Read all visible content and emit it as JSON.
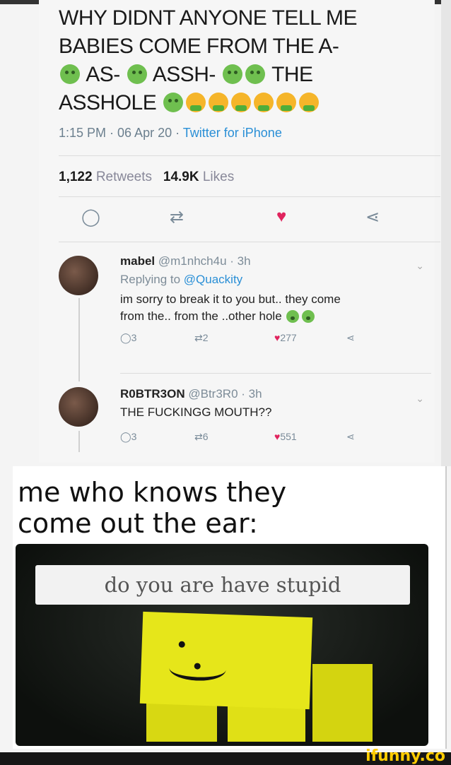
{
  "tweet": {
    "line1": "WHY DIDNT ANYONE TELL ME",
    "line2": "BABIES COME FROM THE A-",
    "line3_a": "AS-",
    "line3_b": "ASSH-",
    "line3_c": "THE",
    "line4": "ASSHOLE",
    "meta_time": "1:15 PM · 06 Apr 20 · ",
    "meta_source": "Twitter for iPhone",
    "retweets_count": "1,122",
    "retweets_label": "Retweets",
    "likes_count": "14.9K",
    "likes_label": "Likes"
  },
  "replies": [
    {
      "name": "mabel",
      "handle": "@m1nhch4u · 3h",
      "replying_prefix": "Replying to ",
      "replying_to": "@Quackity",
      "text_line1": "im sorry to break it to you but.. they come",
      "text_line2": "from the.. from the ..other hole",
      "replies": "3",
      "retweets": "2",
      "likes": "277"
    },
    {
      "name": "R0BTR3ON",
      "handle": "@Btr3R0 · 3h",
      "text_line1": "THE FUCKINGG MOUTH??",
      "replies": "3",
      "retweets": "6",
      "likes": "551"
    }
  ],
  "meme": {
    "caption_line1": "me who knows they",
    "caption_line2": "come out the ear:",
    "speech": "do you are have stupid"
  },
  "watermark": "ifunny.co",
  "colors": {
    "link": "#2a8fd6",
    "heart": "#e0245e",
    "noob_yellow": "#e6e61a",
    "watermark": "#ffcc00"
  }
}
